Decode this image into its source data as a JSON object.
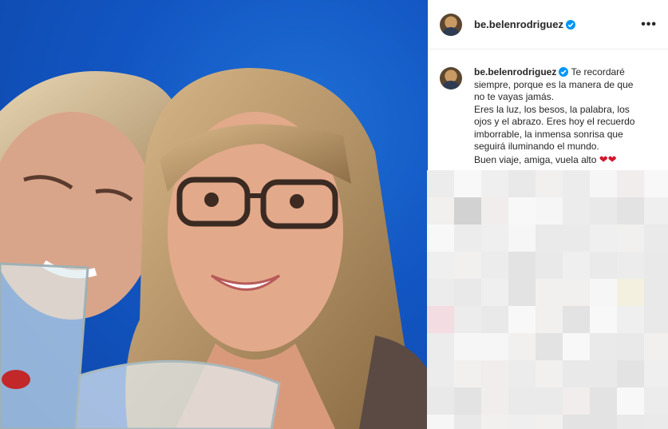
{
  "post": {
    "username": "be.belenrodriguez",
    "verified": true,
    "caption_lines": [
      "Te recordaré",
      "siempre, porque es la manera de que",
      "no te vayas jamás.",
      "Eres la luz, los besos, la palabra, los",
      "ojos y el abrazo. Eres hoy el recuerdo",
      "imborrable, la inmensa sonrisa que",
      "seguirá iluminando el mundo.",
      "Buen viaje, amiga, vuela alto"
    ],
    "caption_emoji": "❤❤"
  },
  "icons": {
    "verified": "verified-badge-icon",
    "more": "more-options-icon"
  },
  "colors": {
    "verified_blue": "#0095f6",
    "heart_red": "#d4162c",
    "background_blue": "#1255c2"
  }
}
